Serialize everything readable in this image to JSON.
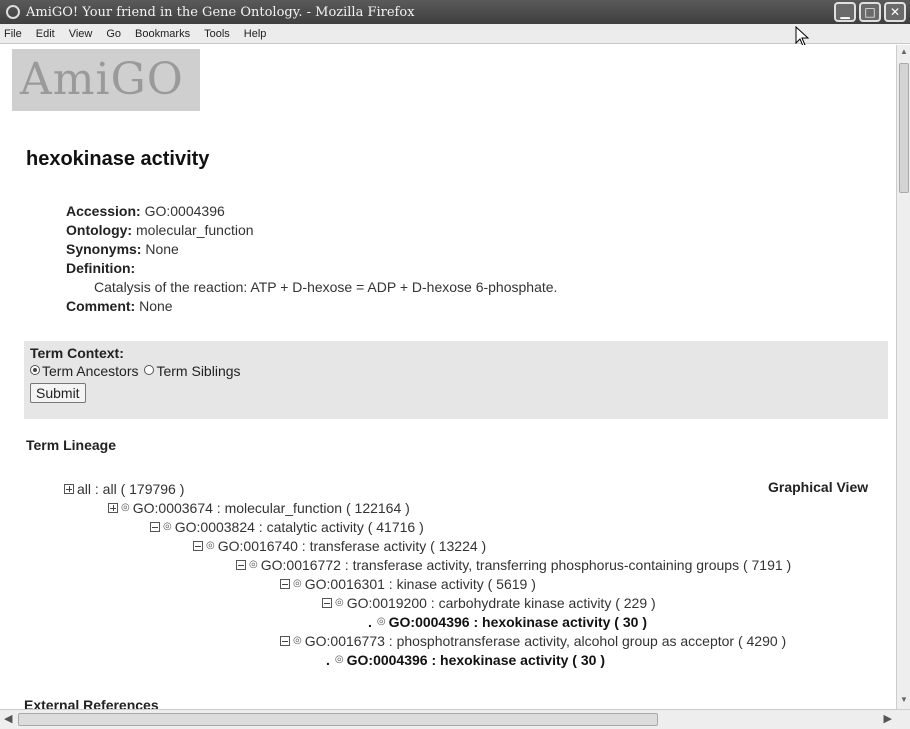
{
  "window": {
    "title": "AmiGO! Your friend in the Gene Ontology. - Mozilla Firefox",
    "buttons": [
      "minimize",
      "maximize",
      "close"
    ]
  },
  "menu": [
    "File",
    "Edit",
    "View",
    "Go",
    "Bookmarks",
    "Tools",
    "Help"
  ],
  "logo_text": "AmiGO",
  "term": {
    "name": "hexokinase activity",
    "accession_label": "Accession:",
    "accession": "GO:0004396",
    "ontology_label": "Ontology:",
    "ontology": "molecular_function",
    "synonyms_label": "Synonyms:",
    "synonyms": "None",
    "definition_label": "Definition:",
    "definition": "Catalysis of the reaction: ATP + D-hexose = ADP + D-hexose 6-phosphate.",
    "comment_label": "Comment:",
    "comment": "None"
  },
  "context": {
    "label": "Term Context:",
    "option_ancestors": "Term Ancestors",
    "option_siblings": "Term Siblings",
    "selected": "Term Ancestors",
    "submit": "Submit"
  },
  "lineage": {
    "title": "Term Lineage",
    "graphical_view": "Graphical View",
    "nodes": [
      {
        "text": "all : all ( 179796 )"
      },
      {
        "text": "GO:0003674 : molecular_function ( 122164 )"
      },
      {
        "text": "GO:0003824 : catalytic activity ( 41716 )"
      },
      {
        "text": "GO:0016740 : transferase activity ( 13224 )"
      },
      {
        "text": "GO:0016772 : transferase activity, transferring phosphorus-containing groups ( 7191 )"
      },
      {
        "text": "GO:0016301 : kinase activity ( 5619 )"
      },
      {
        "text": "GO:0019200 : carbohydrate kinase activity ( 229 )"
      },
      {
        "text": "GO:0004396 : hexokinase activity ( 30 )"
      },
      {
        "text": "GO:0016773 : phosphotransferase activity, alcohol group as acceptor ( 4290 )"
      },
      {
        "text": "GO:0004396 : hexokinase activity ( 30 )"
      }
    ]
  },
  "external_references_label": "External References"
}
